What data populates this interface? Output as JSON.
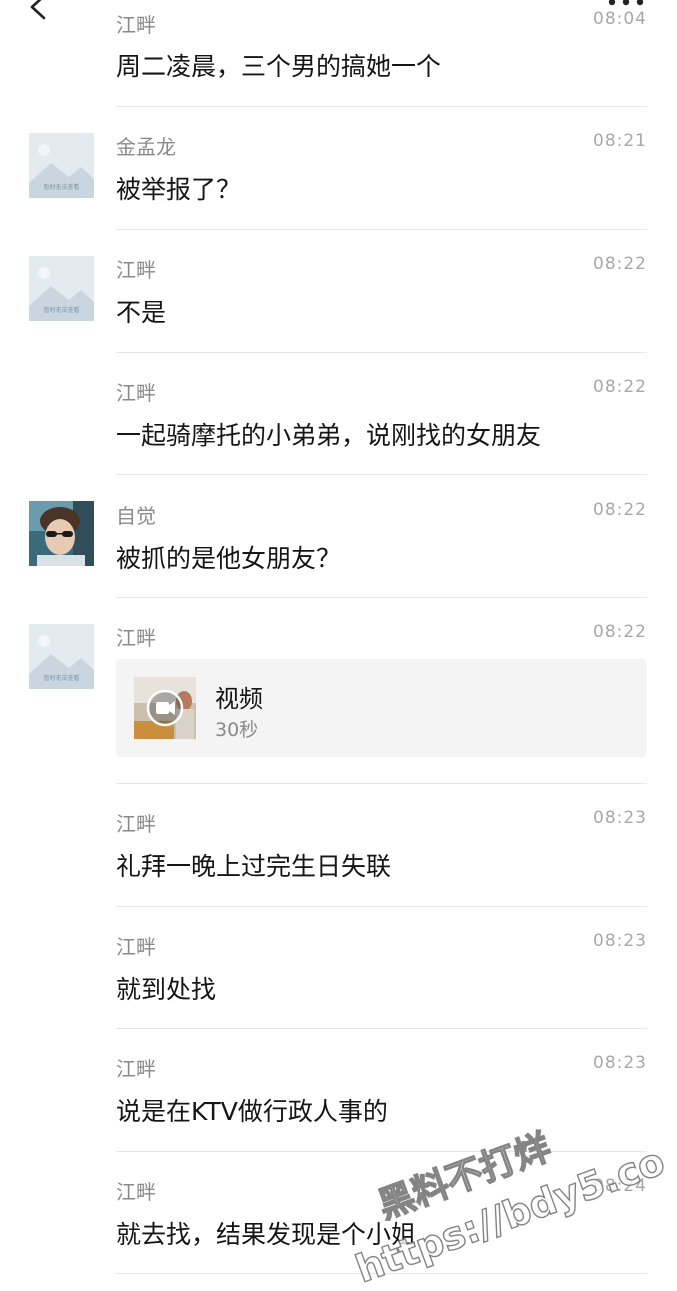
{
  "header": {
    "back_icon": "chevron-left-icon",
    "more_icon": "ellipsis-icon"
  },
  "messages": [
    {
      "sender": "江畔",
      "time": "08:04",
      "text": "周二凌晨，三个男的搞她一个"
    },
    {
      "sender": "金孟龙",
      "time": "08:21",
      "text": "被举报了？"
    },
    {
      "sender": "江畔",
      "time": "08:22",
      "text": "不是"
    },
    {
      "sender": "江畔",
      "time": "08:22",
      "text": "一起骑摩托的小弟弟，说刚找的女朋友"
    },
    {
      "sender": "自觉",
      "time": "08:22",
      "text": "被抓的是他女朋友？"
    },
    {
      "sender": "江畔",
      "time": "08:22",
      "video": {
        "title": "视频",
        "duration": "30秒"
      }
    },
    {
      "sender": "江畔",
      "time": "08:23",
      "text": "礼拜一晚上过完生日失联"
    },
    {
      "sender": "江畔",
      "time": "08:23",
      "text": "就到处找"
    },
    {
      "sender": "江畔",
      "time": "08:23",
      "text": "说是在KTV做行政人事的"
    },
    {
      "sender": "江畔",
      "time": "08:24",
      "text": "就去找，结果发现是个小姐"
    }
  ],
  "avatar_placeholder_caption": "暂时无法查看",
  "watermark": {
    "line1": "黑料不打烊",
    "line2": "https://bdy5.co"
  },
  "colors": {
    "background": "#ffffff",
    "sender_name": "#8a8a8a",
    "timestamp": "#a8a8a8",
    "message_text": "#151515",
    "divider": "#e6e6e6",
    "video_card_bg": "#f4f4f4"
  }
}
